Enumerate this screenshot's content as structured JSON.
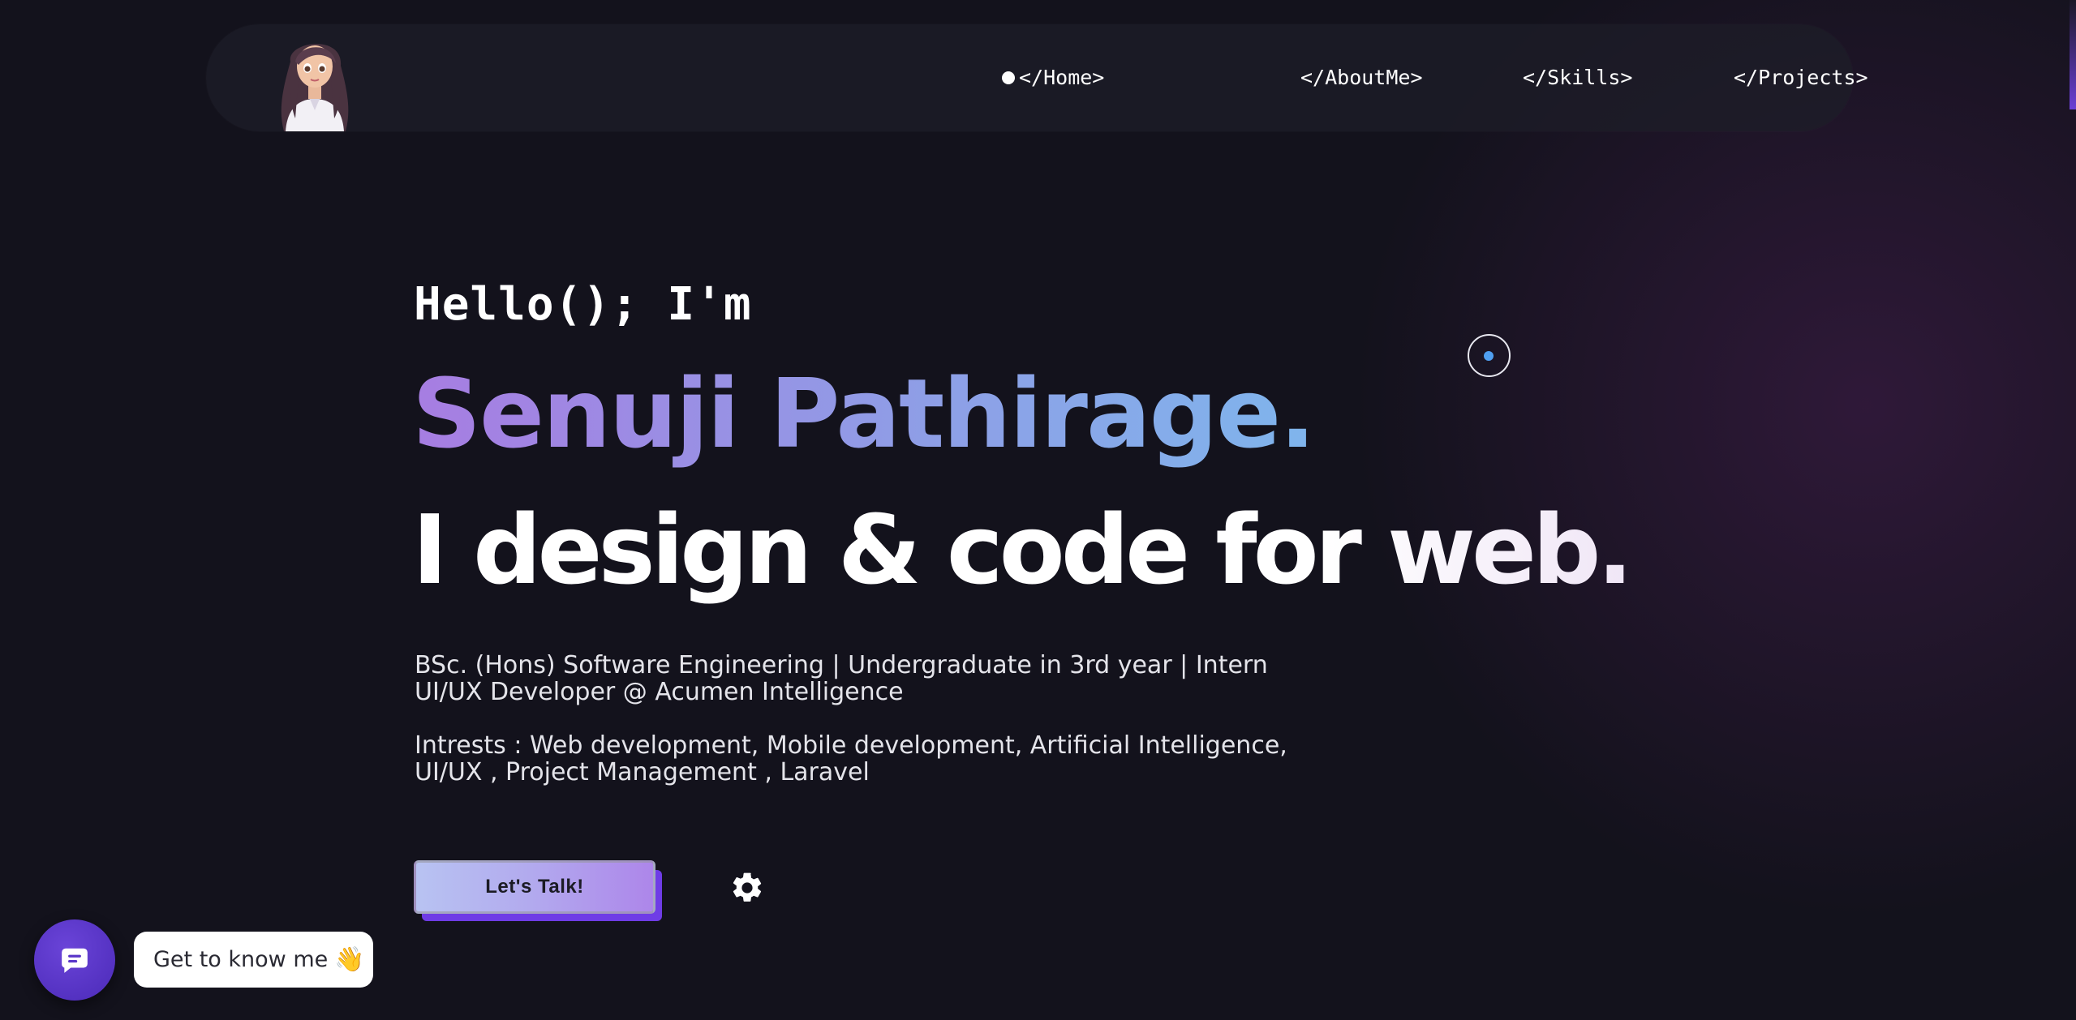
{
  "nav": {
    "logo_alt": "avatar",
    "links": [
      {
        "label": "</Home>",
        "active": true
      },
      {
        "label": "</AboutMe>",
        "active": false
      },
      {
        "label": "</Skills>",
        "active": false
      },
      {
        "label": "</Projects>",
        "active": false
      }
    ]
  },
  "hero": {
    "greeting": "Hello(); I'm",
    "name": "Senuji Pathirage.",
    "tagline": "I design & code for web.",
    "description": "BSc. (Hons) Software Engineering | Undergraduate in 3rd year | Intern UI/UX Developer @ Acumen Intelligence",
    "interests": "Intrests : Web development, Mobile development, Artificial Intelligence, UI/UX , Project Management , Laravel",
    "cta_label": "Let's Talk!"
  },
  "chat": {
    "prompt_text": "Get to know me",
    "prompt_emoji": "👋"
  },
  "icons": {
    "settings": "gear-icon",
    "chat": "chat-bubble-icon",
    "active_nav": "dot-indicator"
  },
  "colors": {
    "background": "#13121c",
    "name_gradient_start": "#a77de2",
    "name_gradient_end": "#7fb5ec",
    "cta_shadow": "#6f3ce6",
    "chat_button": "#5a37c9"
  }
}
